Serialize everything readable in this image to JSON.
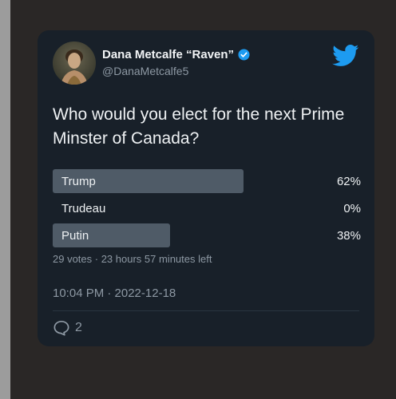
{
  "tweet": {
    "display_name": "Dana Metcalfe “Raven”",
    "handle": "@DanaMetcalfe5",
    "text": "Who would you elect for the next Prime Minster of Canada?",
    "timestamp": "10:04 PM · 2022-12-18",
    "reply_count": "2"
  },
  "poll": {
    "options": [
      {
        "label": "Trump",
        "percent_label": "62%",
        "percent": 62
      },
      {
        "label": "Trudeau",
        "percent_label": "0%",
        "percent": 0
      },
      {
        "label": "Putin",
        "percent_label": "38%",
        "percent": 38
      }
    ],
    "meta": "29 votes · 23 hours 57 minutes left"
  },
  "colors": {
    "card_background": "#182029",
    "poll_bar": "#4f5b67",
    "twitter_blue": "#1d9bf0",
    "verified_badge": "#1d9bf0",
    "muted_text": "#8d98a3"
  },
  "icons": [
    "verified-badge-icon",
    "twitter-bird-icon",
    "reply-icon"
  ]
}
